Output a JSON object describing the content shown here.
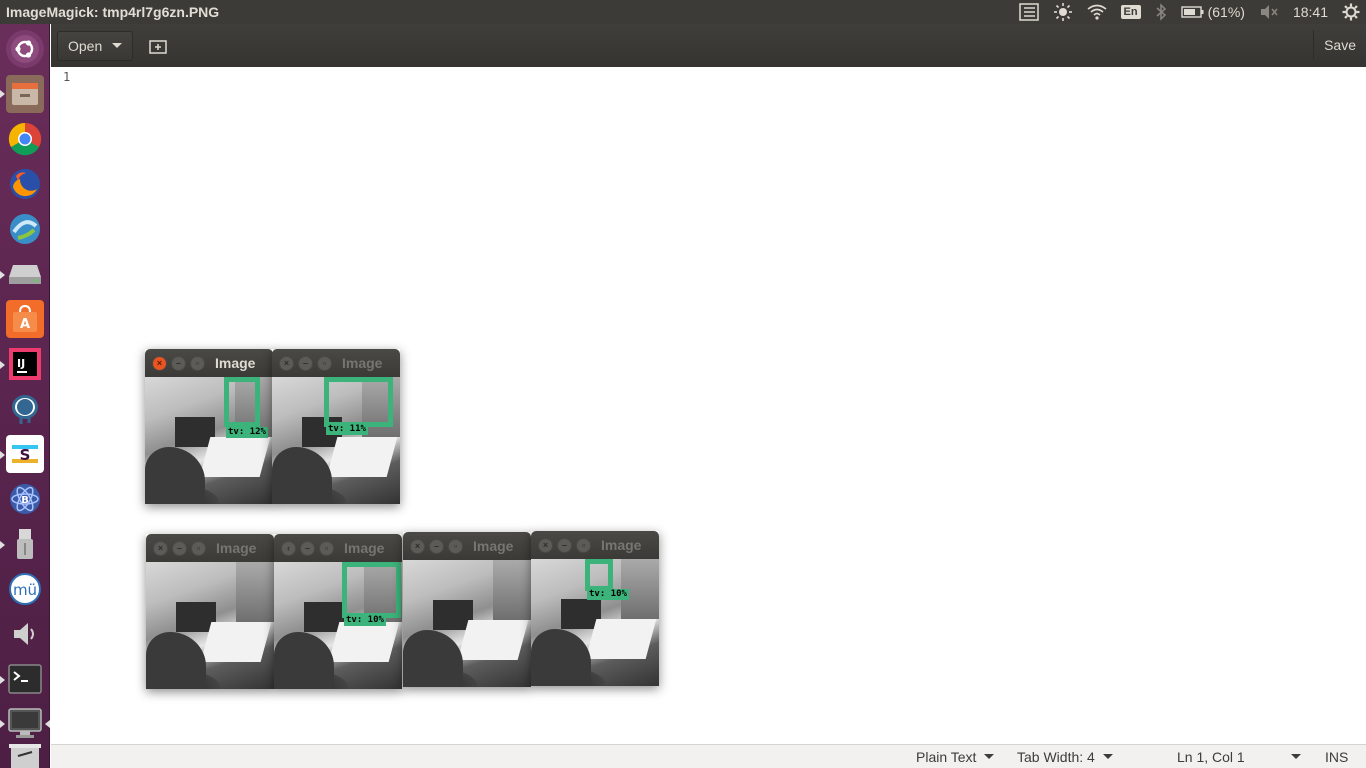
{
  "top_panel": {
    "title": "ImageMagick: tmp4rl7g6zn.PNG",
    "keyboard_layout": "En",
    "battery": "(61%)",
    "time": "18:41",
    "icons": [
      "list-icon",
      "brightness-icon",
      "wifi-icon",
      "keyboard-layout-icon",
      "bluetooth-icon",
      "battery-icon",
      "volume-muted-icon",
      "power-gear-icon"
    ]
  },
  "launcher": {
    "items": [
      {
        "name": "ubuntu-dash-icon"
      },
      {
        "name": "files-icon"
      },
      {
        "name": "chrome-icon"
      },
      {
        "name": "firefox-icon"
      },
      {
        "name": "network-app-icon"
      },
      {
        "name": "drive-icon"
      },
      {
        "name": "software-center-icon"
      },
      {
        "name": "intellij-icon"
      },
      {
        "name": "postgres-icon"
      },
      {
        "name": "slack-icon"
      },
      {
        "name": "atom-icon"
      },
      {
        "name": "usb-icon"
      },
      {
        "name": "musescore-icon"
      },
      {
        "name": "speaker-icon"
      },
      {
        "name": "terminal-icon"
      },
      {
        "name": "display-icon"
      },
      {
        "name": "trash-icon"
      }
    ]
  },
  "editor": {
    "open_label": "Open",
    "save_label": "Save",
    "line_number": "1"
  },
  "status_bar": {
    "language": "Plain Text",
    "tab_width": "Tab Width: 4",
    "position": "Ln 1, Col 1",
    "mode": "INS"
  },
  "image_windows": [
    {
      "title": "Image",
      "active": true,
      "label": "tv: 12%"
    },
    {
      "title": "Image",
      "active": false,
      "label": "tv: 11%"
    },
    {
      "title": "Image",
      "active": false,
      "label": ""
    },
    {
      "title": "Image",
      "active": false,
      "label": "tv: 10%"
    },
    {
      "title": "Image",
      "active": false,
      "label": ""
    },
    {
      "title": "Image",
      "active": false,
      "label": "tv: 10%"
    }
  ],
  "colors": {
    "detection_box": "#3cb37a",
    "close_button": "#e95420",
    "panel": "#3c3b37"
  }
}
